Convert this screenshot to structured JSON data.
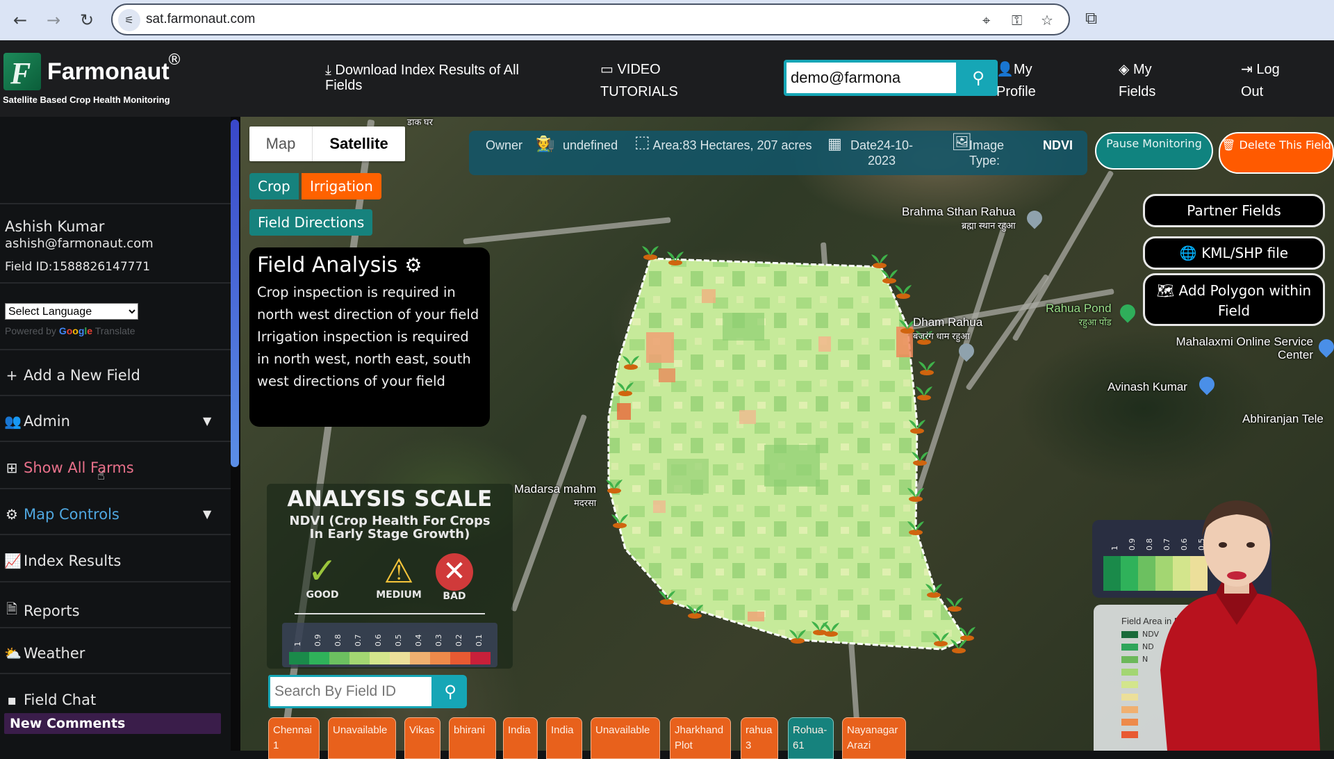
{
  "browser": {
    "url": "sat.farmonaut.com",
    "icons": [
      "back-arrow-icon",
      "forward-arrow-icon",
      "reload-icon",
      "site-settings-icon",
      "location-off-icon",
      "key-icon",
      "star-icon",
      "extensions-icon"
    ]
  },
  "header": {
    "brand": "Farmonaut",
    "registered": "®",
    "tagline": "Satellite Based Crop Health Monitoring",
    "download_label": "Download Index Results of All Fields",
    "video_label": "VIDEO TUTORIALS",
    "search_value": "demo@farmona",
    "profile_label": "My Profile",
    "fields_label": "My Fields",
    "logout_label": "Log Out"
  },
  "sidebar": {
    "user_name": "Ashish Kumar",
    "user_email": "ashish@farmonaut.com",
    "field_id": "Field ID:1588826147771",
    "language_select": "Select Language",
    "powered_by": "Powered by",
    "google": "Google",
    "translate": "Translate",
    "items": [
      {
        "label": "Add a New Field",
        "icon": "plus-icon",
        "color": "#e6e6e6"
      },
      {
        "label": "Admin",
        "icon": "users-gear-icon",
        "color": "#e6e6e6"
      },
      {
        "label": "Show All Farms",
        "icon": "grid-icon",
        "color": "#e8708a"
      },
      {
        "label": "Map Controls",
        "icon": "gear-icon",
        "color": "#4fa7e0"
      },
      {
        "label": "Index Results",
        "icon": "chart-line-icon",
        "color": "#e6e6e6"
      },
      {
        "label": "Reports",
        "icon": "file-icon",
        "color": "#e6e6e6"
      },
      {
        "label": "Weather",
        "icon": "cloud-sun-icon",
        "color": "#e6e6e6"
      },
      {
        "label": "Field Chat",
        "icon": "chat-icon",
        "color": "#e6e6e6"
      }
    ],
    "new_comments": "New Comments"
  },
  "map": {
    "map_type": {
      "map": "Map",
      "satellite": "Satellite",
      "selected": "Satellite"
    },
    "crop_label": "Crop",
    "irrigation_label": "Irrigation",
    "field_directions_label": "Field Directions",
    "info": {
      "owner_label": "Owner",
      "owner_value": "undefined",
      "area": "Area:83 Hectares, 207 acres",
      "date": "Date24-10-2023",
      "image_type_label": "Image Type:",
      "image_type_value": "NDVI"
    },
    "pause_label": "Pause Monitoring",
    "delete_label": "Delete This Field",
    "partner_label": "Partner Fields",
    "kml_label": "KML/SHP file",
    "polygon_label": "Add Polygon within Field",
    "labels": [
      {
        "text": "Brahma Sthan Rahua",
        "sub": "ब्रह्मा स्थान रहुआ"
      },
      {
        "text": "Dham Rahua",
        "sub": "बजरंग धाम रहुआ"
      },
      {
        "text": "Rahua Pond",
        "sub": "रहुआ पोंड"
      },
      {
        "text": "Mahalaxmi Online Service Center",
        "sub": ""
      },
      {
        "text": "Avinash Kumar",
        "sub": ""
      },
      {
        "text": "Abhiranjan Tele",
        "sub": ""
      },
      {
        "text": "Madarsa mahm",
        "sub": "मदरसा"
      },
      {
        "text": "डाक घर",
        "sub": ""
      }
    ],
    "field_analysis": {
      "title": "Field Analysis",
      "crop_text": "Crop inspection is required in north west direction of your field",
      "irrigation_text": "Irrigation inspection is required in north west, north east, south west directions of your field"
    },
    "analysis_scale": {
      "title": "ANALYSIS SCALE",
      "subtitle_1": "NDVI (Crop Health For Crops",
      "subtitle_2": "In Early Stage Growth)",
      "good": "GOOD",
      "medium": "MEDIUM",
      "bad": "BAD",
      "ticks": [
        "1",
        "0.9",
        "0.8",
        "0.7",
        "0.6",
        "0.5",
        "0.4",
        "0.3",
        "0.2",
        "0.1"
      ],
      "colors": [
        "#1a8a4a",
        "#2fb25a",
        "#6cc060",
        "#a3d672",
        "#d3e58c",
        "#ecdf9a",
        "#f0b070",
        "#ee8a4a",
        "#e85a32",
        "#c8203a"
      ]
    },
    "search_placeholder": "Search By Field ID",
    "field_tabs": [
      {
        "label": "Chennai\n1",
        "color": "orange"
      },
      {
        "label": "Unavailable",
        "color": "orange"
      },
      {
        "label": "Vikas",
        "color": "orange"
      },
      {
        "label": "bhirani",
        "color": "orange"
      },
      {
        "label": "India",
        "color": "orange"
      },
      {
        "label": "India",
        "color": "orange"
      },
      {
        "label": "Unavailable",
        "color": "orange"
      },
      {
        "label": "Jharkhand\nPlot",
        "color": "orange"
      },
      {
        "label": "rahua\n3",
        "color": "orange"
      },
      {
        "label": "Rohua-\n61",
        "color": "teal"
      },
      {
        "label": "Nayanagar\nArazi",
        "color": "orange"
      }
    ]
  },
  "presenter_inset": {
    "ticks": [
      "1",
      "0.9",
      "0.8",
      "0.7",
      "0.6",
      "0.5"
    ],
    "legend_caption": "Field Area in Di",
    "legend_rows": [
      "NDV",
      "ND",
      "N"
    ]
  }
}
